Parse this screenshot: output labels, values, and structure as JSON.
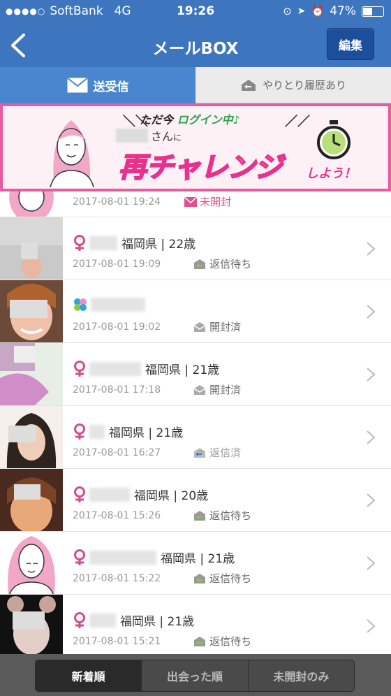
{
  "status_bar": {
    "carrier": "SoftBank",
    "network": "4G",
    "time": "19:26",
    "battery": "47%"
  },
  "nav": {
    "title": "メールBOX",
    "edit_label": "編集"
  },
  "tabs": [
    {
      "label": "送受信",
      "icon": "envelope-icon",
      "active": true
    },
    {
      "label": "やりとり履歴あり",
      "icon": "exchange-envelope-icon",
      "active": false
    }
  ],
  "banner": {
    "line1_prefix": "ただ今",
    "line1_highlight": "ログイン中♪",
    "san": "さん",
    "ni": "に",
    "big": "再チャレンジ",
    "small": "しよう！"
  },
  "messages": [
    {
      "partial": true,
      "datetime": "2017-08-01 19:24",
      "status": "未開封",
      "status_type": "unread"
    },
    {
      "gender_icon": "female-icon",
      "location_age": "福岡県 | 22歳",
      "datetime": "2017-08-01 19:09",
      "status": "返信待ち",
      "status_type": "waiting"
    },
    {
      "gender_icon": "clover-icon",
      "location_age": "",
      "datetime": "2017-08-01 19:02",
      "status": "開封済",
      "status_type": "opened"
    },
    {
      "gender_icon": "female-icon",
      "location_age": "福岡県 | 21歳",
      "datetime": "2017-08-01 17:18",
      "status": "開封済",
      "status_type": "opened"
    },
    {
      "gender_icon": "female-icon",
      "location_age": "福岡県 | 21歳",
      "datetime": "2017-08-01 16:27",
      "status": "返信済",
      "status_type": "replied"
    },
    {
      "gender_icon": "female-icon",
      "location_age": "福岡県 | 20歳",
      "datetime": "2017-08-01 15:26",
      "status": "返信待ち",
      "status_type": "waiting"
    },
    {
      "gender_icon": "female-icon",
      "location_age": "福岡県 | 21歳",
      "datetime": "2017-08-01 15:22",
      "status": "返信待ち",
      "status_type": "waiting"
    },
    {
      "gender_icon": "female-icon",
      "location_age": "福岡県 | 21歳",
      "datetime": "2017-08-01 15:21",
      "status": "返信待ち",
      "status_type": "waiting"
    }
  ],
  "sort_options": [
    "新着順",
    "出会った順",
    "未開封のみ"
  ],
  "colors": {
    "nav_blue": "#3d75bf",
    "accent_pink": "#e0508e",
    "banner_border": "#ea5aa0"
  }
}
